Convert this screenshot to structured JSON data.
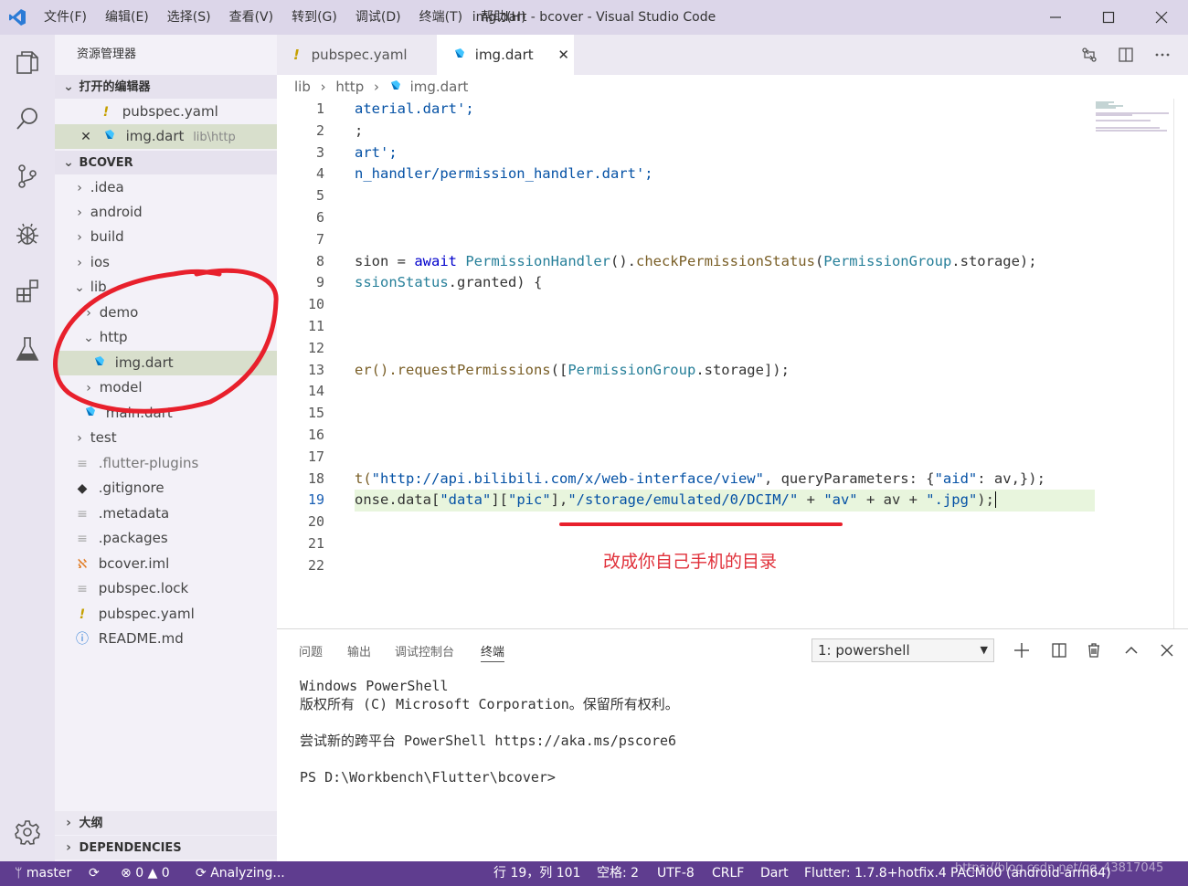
{
  "titlebar": {
    "title": "img.dart - bcover - Visual Studio Code",
    "menu": [
      "文件(F)",
      "编辑(E)",
      "选择(S)",
      "查看(V)",
      "转到(G)",
      "调试(D)",
      "终端(T)",
      "帮助(H)"
    ]
  },
  "sidebar": {
    "title": "资源管理器",
    "open_editors_header": "打开的编辑器",
    "open_editors": [
      {
        "name": "pubspec.yaml",
        "path": ""
      },
      {
        "name": "img.dart",
        "path": "lib\\http"
      }
    ],
    "project_header": "BCOVER",
    "tree": [
      {
        "label": ".idea"
      },
      {
        "label": "android"
      },
      {
        "label": "build"
      },
      {
        "label": "ios"
      },
      {
        "label": "lib"
      },
      {
        "label": "demo"
      },
      {
        "label": "http"
      },
      {
        "label": "img.dart"
      },
      {
        "label": "model"
      },
      {
        "label": "main.dart"
      },
      {
        "label": "test"
      },
      {
        "label": ".flutter-plugins"
      },
      {
        "label": ".gitignore"
      },
      {
        "label": ".metadata"
      },
      {
        "label": ".packages"
      },
      {
        "label": "bcover.iml"
      },
      {
        "label": "pubspec.lock"
      },
      {
        "label": "pubspec.yaml"
      },
      {
        "label": "README.md"
      }
    ],
    "outline_header": "大纲",
    "dependencies_header": "DEPENDENCIES"
  },
  "tabs": [
    {
      "label": "pubspec.yaml"
    },
    {
      "label": "img.dart"
    }
  ],
  "breadcrumb": {
    "parts": [
      "lib",
      "http",
      "img.dart"
    ]
  },
  "editor": {
    "line_numbers": [
      "1",
      "2",
      "3",
      "4",
      "5",
      "6",
      "7",
      "8",
      "9",
      "10",
      "11",
      "12",
      "13",
      "14",
      "15",
      "16",
      "17",
      "18",
      "19",
      "20",
      "21",
      "22"
    ],
    "current_line": "19",
    "lines": {
      "l1": "aterial.dart';",
      "l2": ";",
      "l3": "art';",
      "l4": "n_handler/permission_handler.dart';",
      "l8_a": "sion = ",
      "l8_b": "await",
      "l8_c": " ",
      "l8_d": "PermissionHandler",
      "l8_e": "().",
      "l8_f": "checkPermissionStatus",
      "l8_g": "(",
      "l8_h": "PermissionGroup",
      "l8_i": ".storage);",
      "l9_a": "ssionStatus",
      "l9_b": ".granted) {",
      "l13_a": "er().",
      "l13_b": "requestPermissions",
      "l13_c": "([",
      "l13_d": "PermissionGroup",
      "l13_e": ".storage]);",
      "l18_a": "t(",
      "l18_b": "\"http://api.bilibili.com/x/web-interface/view\"",
      "l18_c": ", queryParameters: {",
      "l18_d": "\"aid\"",
      "l18_e": ": av,});",
      "l19_a": "onse.data[",
      "l19_b": "\"data\"",
      "l19_c": "][",
      "l19_d": "\"pic\"",
      "l19_e": "],",
      "l19_f": "\"/storage/emulated/0/DCIM/\"",
      "l19_g": " + ",
      "l19_h": "\"av\"",
      "l19_i": " + av + ",
      "l19_j": "\".jpg\"",
      "l19_k": ");"
    }
  },
  "panel": {
    "tabs": [
      "问题",
      "输出",
      "调试控制台",
      "终端"
    ],
    "terminal_select": "1: powershell",
    "terminal_lines": [
      "Windows PowerShell",
      "版权所有 (C) Microsoft Corporation。保留所有权利。",
      "尝试新的跨平台 PowerShell https://aka.ms/pscore6",
      "PS D:\\Workbench\\Flutter\\bcover>"
    ]
  },
  "statusbar": {
    "branch": "master",
    "errors": "0",
    "warnings": "0",
    "analyzing": "Analyzing...",
    "position": "行 19，列 101",
    "spaces": "空格: 2",
    "encoding": "UTF-8",
    "eol": "CRLF",
    "language": "Dart",
    "flutter": "Flutter: 1.7.8+hotfix.4",
    "device": "PACM00 (android-arm64)",
    "watermark": "https://blog.csdn.net/qq_43817045"
  },
  "annotation": {
    "note": "改成你自己手机的目录",
    "color": "#e0303a"
  },
  "colors": {
    "title_bar": "#dcd6e9",
    "status_bar": "#5f3d8f",
    "selection": "#d8dfcc",
    "current_line": "#e8f5dd"
  }
}
